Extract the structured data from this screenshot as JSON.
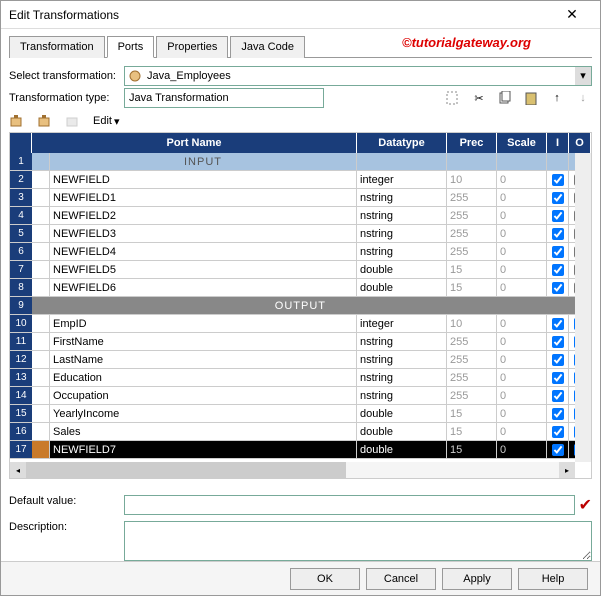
{
  "window": {
    "title": "Edit Transformations"
  },
  "watermark": "©tutorialgateway.org",
  "tabs": [
    "Transformation",
    "Ports",
    "Properties",
    "Java Code"
  ],
  "active_tab": 1,
  "fields": {
    "select_label": "Select transformation:",
    "select_value": "Java_Employees",
    "type_label": "Transformation type:",
    "type_value": "Java Transformation",
    "edit_label": "Edit",
    "default_label": "Default value:",
    "default_value": "",
    "desc_label": "Description:",
    "desc_value": ""
  },
  "grid": {
    "headers": {
      "name": "Port Name",
      "type": "Datatype",
      "prec": "Prec",
      "scale": "Scale",
      "i": "I",
      "o": "O"
    },
    "section_input": "INPUT",
    "section_output": "OUTPUT",
    "input_rows": [
      {
        "n": 2,
        "name": "NEWFIELD",
        "type": "integer",
        "prec": "10",
        "scale": "0",
        "i": true,
        "o": false
      },
      {
        "n": 3,
        "name": "NEWFIELD1",
        "type": "nstring",
        "prec": "255",
        "scale": "0",
        "i": true,
        "o": false
      },
      {
        "n": 4,
        "name": "NEWFIELD2",
        "type": "nstring",
        "prec": "255",
        "scale": "0",
        "i": true,
        "o": false
      },
      {
        "n": 5,
        "name": "NEWFIELD3",
        "type": "nstring",
        "prec": "255",
        "scale": "0",
        "i": true,
        "o": false
      },
      {
        "n": 6,
        "name": "NEWFIELD4",
        "type": "nstring",
        "prec": "255",
        "scale": "0",
        "i": true,
        "o": false
      },
      {
        "n": 7,
        "name": "NEWFIELD5",
        "type": "double",
        "prec": "15",
        "scale": "0",
        "i": true,
        "o": false
      },
      {
        "n": 8,
        "name": "NEWFIELD6",
        "type": "double",
        "prec": "15",
        "scale": "0",
        "i": true,
        "o": false
      }
    ],
    "output_rows": [
      {
        "n": 10,
        "name": "EmpID",
        "type": "integer",
        "prec": "10",
        "scale": "0",
        "i": true,
        "o": true
      },
      {
        "n": 11,
        "name": "FirstName",
        "type": "nstring",
        "prec": "255",
        "scale": "0",
        "i": true,
        "o": true
      },
      {
        "n": 12,
        "name": "LastName",
        "type": "nstring",
        "prec": "255",
        "scale": "0",
        "i": true,
        "o": true
      },
      {
        "n": 13,
        "name": "Education",
        "type": "nstring",
        "prec": "255",
        "scale": "0",
        "i": true,
        "o": true
      },
      {
        "n": 14,
        "name": "Occupation",
        "type": "nstring",
        "prec": "255",
        "scale": "0",
        "i": true,
        "o": true
      },
      {
        "n": 15,
        "name": "YearlyIncome",
        "type": "double",
        "prec": "15",
        "scale": "0",
        "i": true,
        "o": true
      },
      {
        "n": 16,
        "name": "Sales",
        "type": "double",
        "prec": "15",
        "scale": "0",
        "i": true,
        "o": true
      }
    ],
    "selected_row": {
      "n": 17,
      "name": "NEWFIELD7",
      "type": "double",
      "prec": "15",
      "scale": "0",
      "i": true,
      "o": true
    }
  },
  "footer": {
    "ok": "OK",
    "cancel": "Cancel",
    "apply": "Apply",
    "help": "Help"
  }
}
